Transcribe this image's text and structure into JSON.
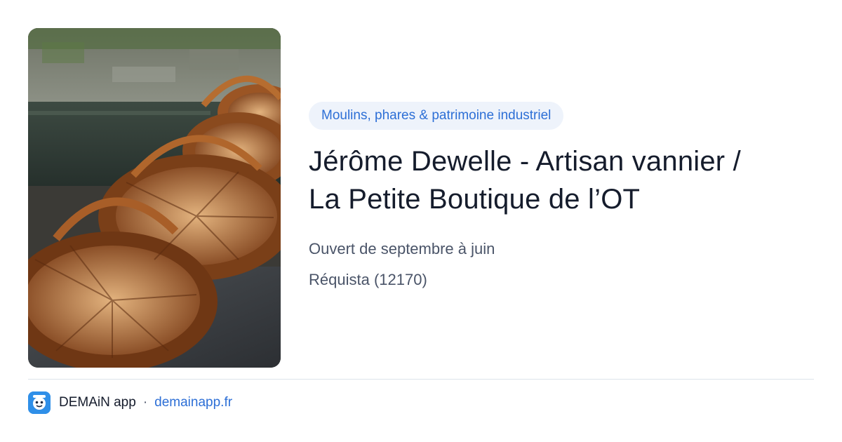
{
  "category": "Moulins, phares & patrimoine industriel",
  "title_line1": "Jérôme Dewelle - Artisan vannier /",
  "title_line2": "La Petite Boutique de l’OT",
  "opening": "Ouvert de septembre à juin",
  "location": "Réquista (12170)",
  "footer": {
    "app_name": "DEMAiN app",
    "separator": "·",
    "domain": "demainapp.fr"
  },
  "image": {
    "subject": "woven wicker baskets by a river",
    "icon": "photo-wicker-baskets"
  },
  "colors": {
    "accent": "#2d6fd6",
    "pill_bg": "#eef3fb",
    "title": "#151c2c",
    "muted": "#4a5468",
    "app_icon": "#2f8fe8"
  }
}
